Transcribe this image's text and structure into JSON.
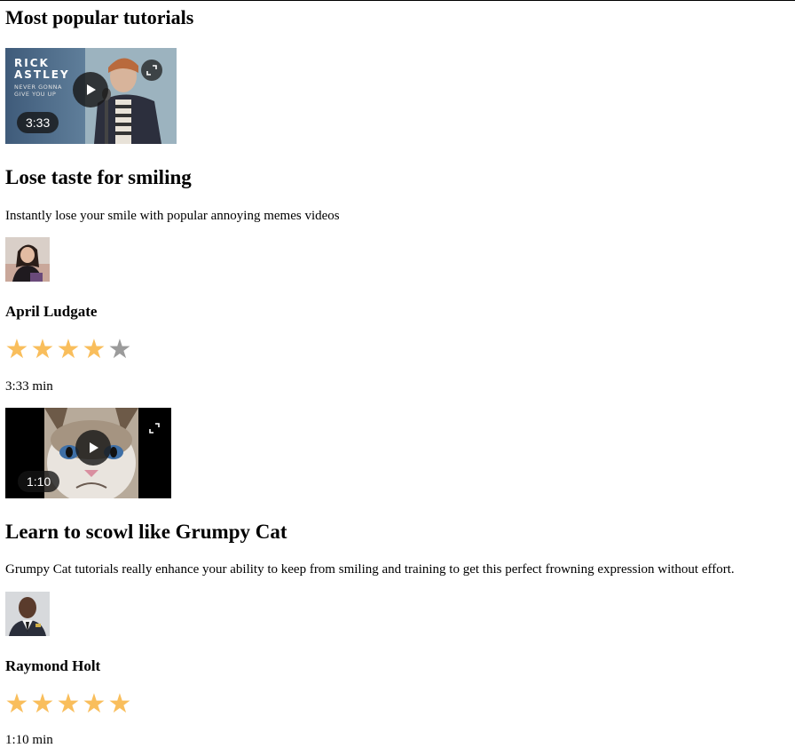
{
  "section": {
    "title": "Most popular tutorials"
  },
  "cards": [
    {
      "thumbnail": {
        "overlay_title_line1": "RICK",
        "overlay_title_line2": "ASTLEY",
        "overlay_subtitle_line1": "NEVER GONNA",
        "overlay_subtitle_line2": "GIVE YOU UP",
        "time": "3:33"
      },
      "title": "Lose taste for smiling",
      "description": "Instantly lose your smile with popular annoying memes videos",
      "author": "April Ludgate",
      "rating": 4,
      "rating_max": 5,
      "duration": "3:33 min"
    },
    {
      "thumbnail": {
        "time": "1:10"
      },
      "title": "Learn to scowl like Grumpy Cat",
      "description": "Grumpy Cat tutorials really enhance your ability to keep from smiling and training to get this perfect frowning expression without effort.",
      "author": "Raymond Holt",
      "rating": 5,
      "rating_max": 5,
      "duration": "1:10 min"
    }
  ],
  "colors": {
    "star_filled": "#f9be5c",
    "star_empty": "#9b9b9b"
  },
  "icons": {
    "play": "play-icon",
    "expand": "expand-icon",
    "star": "star-icon"
  }
}
